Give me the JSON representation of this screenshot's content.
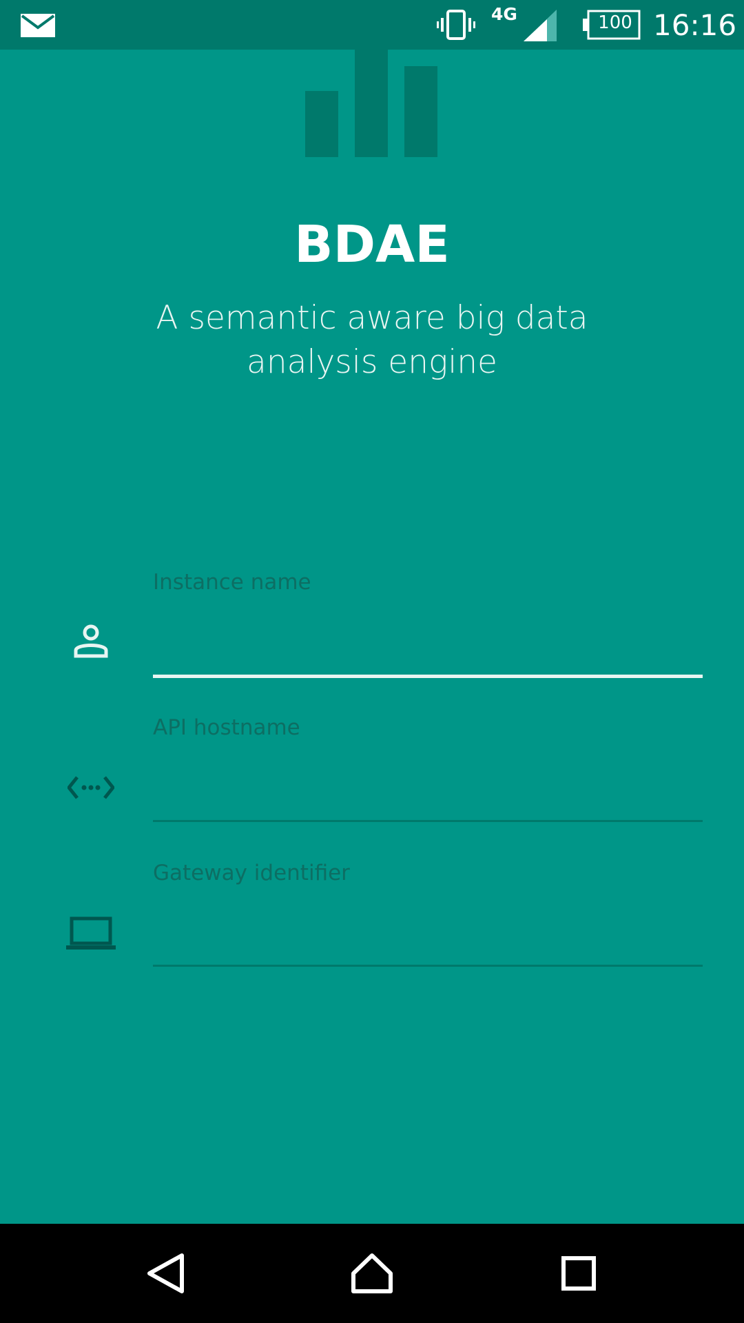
{
  "status_bar": {
    "notification_icon": "mail-icon",
    "vibrate_icon": "vibrate-icon",
    "network_label": "4G",
    "signal_icon": "signal-icon",
    "battery_level": "100",
    "time": "16:16"
  },
  "header": {
    "logo_icon": "bar-chart-logo-icon",
    "title": "BDAE",
    "subtitle": "A semantic aware big data analysis engine"
  },
  "form": {
    "instance_name": {
      "icon": "person-icon",
      "label": "Instance name",
      "value": ""
    },
    "api_hostname": {
      "icon": "code-ellipsis-icon",
      "label": "API hostname",
      "value": ""
    },
    "gateway_identifier": {
      "icon": "laptop-icon",
      "label": "Gateway identifier",
      "value": ""
    }
  },
  "nav_bar": {
    "back_icon": "back-icon",
    "home_icon": "home-icon",
    "recents_icon": "recents-icon"
  },
  "colors": {
    "background": "#009688",
    "status_bar": "#00796b",
    "field_label": "#0d6e63",
    "focused_underline": "#e8f5f2",
    "unfocused_underline": "#00796b"
  }
}
